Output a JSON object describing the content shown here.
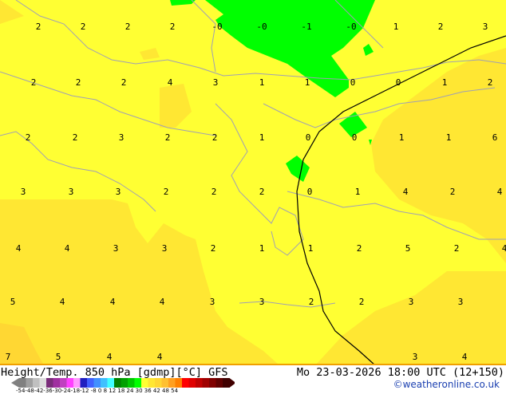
{
  "map": {
    "title": "Height/Temp. 850 hPa [gdmp][°C] GFS",
    "datetime": "Mo 23-03-2026 18:00 UTC (12+150)",
    "credit": "©weatheronline.co.uk",
    "colors": {
      "warm_yellow": "#ffff33",
      "darker_yellow": "#ffe733",
      "orange_yellow": "#ffd733",
      "green": "#00ff00",
      "border": "#a0a0b4",
      "line": "#000000"
    },
    "labels": [
      "2",
      "2",
      "2",
      "2",
      "-0",
      "-0",
      "-1",
      "-0",
      "1",
      "2",
      "3",
      "2",
      "2",
      "2",
      "4",
      "3",
      "1",
      "1",
      "0",
      "0",
      "1",
      "2",
      "2",
      "2",
      "3",
      "2",
      "2",
      "1",
      "0",
      "0",
      "1",
      "1",
      "6",
      "3",
      "3",
      "3",
      "2",
      "2",
      "2",
      "0",
      "1",
      "4",
      "2",
      "4",
      "4",
      "4",
      "3",
      "3",
      "2",
      "1",
      "1",
      "2",
      "5",
      "2",
      "4",
      "5",
      "4",
      "4",
      "4",
      "3",
      "3",
      "2",
      "2",
      "3",
      "3",
      "7",
      "5",
      "4",
      "4",
      "3",
      "4"
    ],
    "legend": {
      "colors": [
        "#808080",
        "#a0a0a0",
        "#c0c0c0",
        "#dcdcdc",
        "#7a2d7a",
        "#a030a0",
        "#c040c0",
        "#ff40ff",
        "#ff99ff",
        "#2020c0",
        "#4060ff",
        "#4090ff",
        "#40c0ff",
        "#40ffff",
        "#008000",
        "#00a000",
        "#00c800",
        "#00ff00",
        "#ffff33",
        "#ffe733",
        "#ffd733",
        "#ffc030",
        "#ffa020",
        "#ff8000",
        "#ff0000",
        "#e00000",
        "#c00000",
        "#a00000",
        "#800000",
        "#600000",
        "#400000"
      ],
      "ticks": "-54-48-42-36-30-24-18-12 -8   0   8  12  18  24  30  36  42  48  54"
    }
  }
}
